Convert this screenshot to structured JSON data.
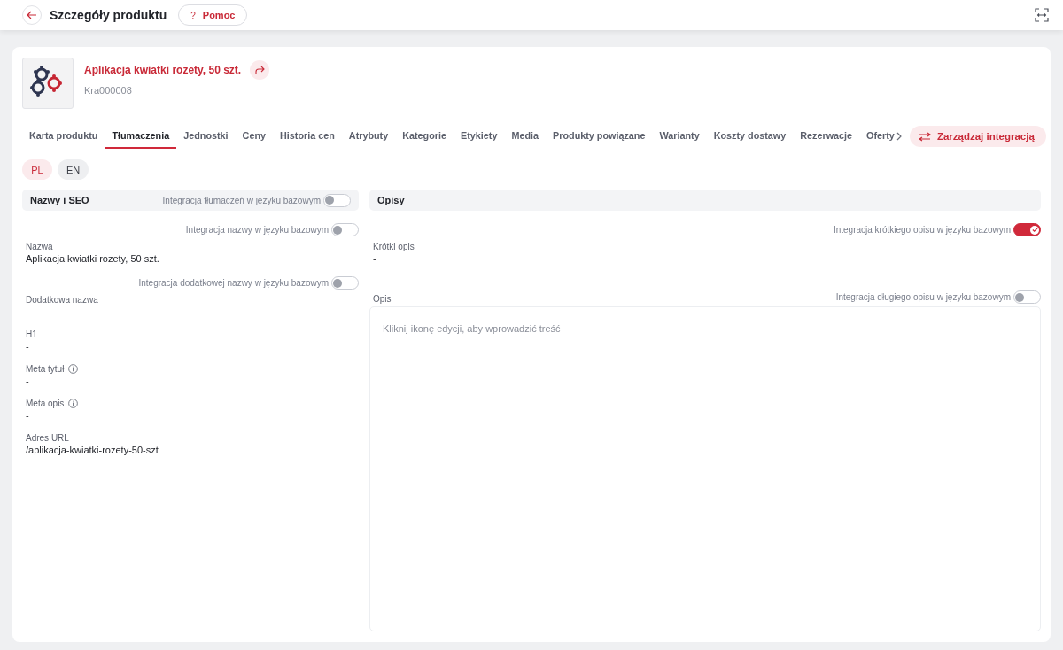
{
  "header": {
    "title": "Szczegóły produktu",
    "help_icon": "?",
    "help_label": "Pomoc"
  },
  "product": {
    "name": "Aplikacja kwiatki rozety, 50 szt.",
    "code": "Kra000008"
  },
  "tabs": [
    {
      "label": "Karta produktu",
      "selected": false
    },
    {
      "label": "Tłumaczenia",
      "selected": true
    },
    {
      "label": "Jednostki",
      "selected": false
    },
    {
      "label": "Ceny",
      "selected": false
    },
    {
      "label": "Historia cen",
      "selected": false
    },
    {
      "label": "Atrybuty",
      "selected": false
    },
    {
      "label": "Kategorie",
      "selected": false
    },
    {
      "label": "Etykiety",
      "selected": false
    },
    {
      "label": "Media",
      "selected": false
    },
    {
      "label": "Produkty powiązane",
      "selected": false
    },
    {
      "label": "Warianty",
      "selected": false
    },
    {
      "label": "Koszty dostawy",
      "selected": false
    },
    {
      "label": "Rezerwacje",
      "selected": false
    },
    {
      "label": "Oferty",
      "selected": false
    }
  ],
  "manage_button": "Zarządzaj integracją",
  "languages": [
    {
      "label": "PL",
      "selected": true
    },
    {
      "label": "EN",
      "selected": false
    }
  ],
  "left_section": {
    "title": "Nazwy i SEO",
    "toggle": {
      "label": "Integracja tłumaczeń w języku bazowym",
      "on": false
    },
    "fields": [
      {
        "label": "Nazwa",
        "value": "Aplikacja kwiatki rozety, 50 szt.",
        "info": false,
        "toggle": {
          "label": "Integracja nazwy w języku bazowym",
          "on": false
        }
      },
      {
        "label": "Dodatkowa nazwa",
        "value": "-",
        "info": false,
        "toggle": {
          "label": "Integracja dodatkowej nazwy w języku bazowym",
          "on": false
        }
      },
      {
        "label": "H1",
        "value": "-",
        "info": false
      },
      {
        "label": "Meta tytuł",
        "value": "-",
        "info": true
      },
      {
        "label": "Meta opis",
        "value": "-",
        "info": true
      },
      {
        "label": "Adres URL",
        "value": "/aplikacja-kwiatki-rozety-50-szt",
        "info": false
      }
    ]
  },
  "right_section": {
    "title": "Opisy",
    "short": {
      "label": "Krótki opis",
      "value": "-",
      "toggle": {
        "label": "Integracja krótkiego opisu w języku bazowym",
        "on": true
      }
    },
    "long": {
      "label": "Opis",
      "placeholder": "Kliknij ikonę edycji, aby wprowadzić treść",
      "toggle": {
        "label": "Integracja długiego opisu w języku bazowym",
        "on": false
      }
    }
  }
}
